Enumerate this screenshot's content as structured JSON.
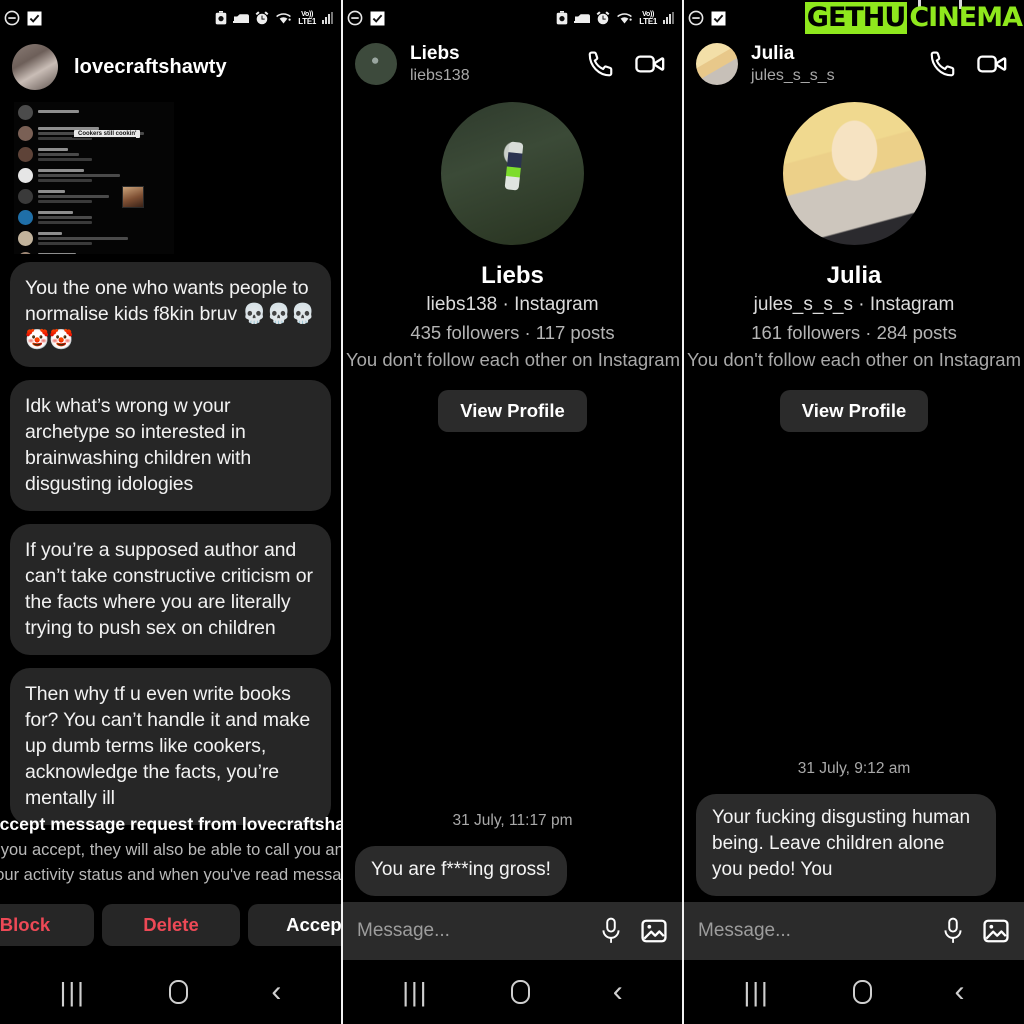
{
  "watermark": {
    "part1": "GETHU",
    "part2": "CINEMA"
  },
  "status_bar": {
    "left_icons": [
      "dnd-minus-icon",
      "checkbox-icon"
    ],
    "right_icons": [
      "battery-saver-icon",
      "bedtime-icon",
      "alarm-icon",
      "wifi-icon"
    ],
    "network_line1": "Vo))",
    "network_line2": "LTE1"
  },
  "nav_bar": {
    "recents": "|||",
    "home": "home-pill",
    "back": "‹"
  },
  "panel1": {
    "header": {
      "username": "lovecraftshawty",
      "avatar": "user-avatar"
    },
    "shared_screenshot": {
      "highlight_tag": "Cookers still cookin'"
    },
    "messages": [
      "You the one who wants people to normalise kids f8kin bruv 💀💀💀🤡🤡",
      "Idk what’s wrong w your archetype so interested in brainwashing children with disgusting idologies",
      "If you’re a supposed author and can’t take constructive criticism or the facts where you are literally trying to push sex on children",
      "Then why tf u even write books for? You can’t handle it and make up dumb terms like cookers, acknowledge the facts, you’re mentally ill"
    ],
    "request": {
      "title_prefix": "Accept message request from ",
      "title_user": "lovecraftshawty?",
      "line2": "If you accept, they will also be able to call you and see info like",
      "line3": "your activity status and when you've read messages.",
      "buttons": [
        {
          "label": "Block",
          "style": "danger"
        },
        {
          "label": "Delete",
          "style": "danger"
        },
        {
          "label": "Accept",
          "style": "neutral"
        }
      ]
    }
  },
  "panel2": {
    "header": {
      "name": "Liebs",
      "handle": "liebs138",
      "avatar": "mountain-biker-avatar",
      "actions": [
        "voice-call-icon",
        "video-call-icon"
      ]
    },
    "profile": {
      "picture": "mountain-biker-photo",
      "name": "Liebs",
      "handle_line": "liebs138 · Instagram",
      "stats": "435 followers · 117 posts",
      "follow_info": "You don't follow each other on Instagram",
      "button_label": "View Profile"
    },
    "timestamp": "31 July, 11:17 pm",
    "message": "You are f***ing gross!",
    "input": {
      "placeholder": "Message...",
      "icons": [
        "microphone-icon",
        "gallery-icon"
      ]
    }
  },
  "panel3": {
    "header": {
      "name": "Julia",
      "handle": "jules_s_s_s",
      "avatar": "blonde-woman-avatar",
      "actions": [
        "voice-call-icon",
        "video-call-icon"
      ]
    },
    "profile": {
      "picture": "blonde-woman-photo",
      "name": "Julia",
      "handle_line": "jules_s_s_s · Instagram",
      "stats": "161 followers · 284 posts",
      "follow_info": "You don't follow each other on Instagram",
      "button_label": "View Profile"
    },
    "timestamp": "31 July, 9:12 am",
    "message": "Your fucking disgusting human being. Leave children alone you pedo! You",
    "input": {
      "placeholder": "Message...",
      "icons": [
        "microphone-icon",
        "gallery-icon"
      ]
    }
  },
  "colors": {
    "background": "#000000",
    "bubble": "#262626",
    "input_bar": "#2b2b2b",
    "danger": "#ed4956",
    "watermark_green": "#8fe81d"
  }
}
